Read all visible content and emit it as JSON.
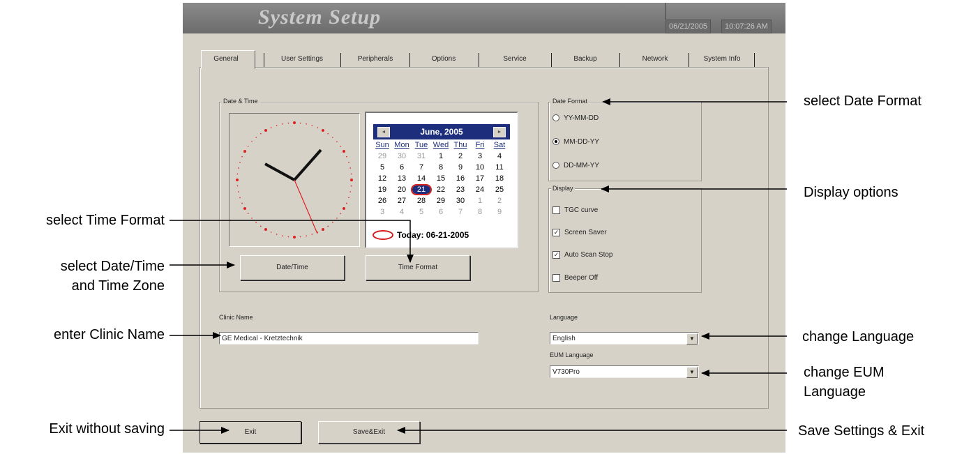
{
  "window": {
    "title": "System Setup",
    "date": "06/21/2005",
    "time": "10:07:26 AM"
  },
  "tabs": [
    "General",
    "User Settings",
    "Peripherals",
    "Options",
    "Service",
    "Backup",
    "Network",
    "System Info"
  ],
  "date_time": {
    "group_label": "Date & Time",
    "datetime_button": "Date/Time",
    "timeformat_button": "Time Format"
  },
  "calendar": {
    "month_label": "June, 2005",
    "days_of_week": [
      "Sun",
      "Mon",
      "Tue",
      "Wed",
      "Thu",
      "Fri",
      "Sat"
    ],
    "weeks": [
      [
        "29",
        "30",
        "31",
        "1",
        "2",
        "3",
        "4"
      ],
      [
        "5",
        "6",
        "7",
        "8",
        "9",
        "10",
        "11"
      ],
      [
        "12",
        "13",
        "14",
        "15",
        "16",
        "17",
        "18"
      ],
      [
        "19",
        "20",
        "21",
        "22",
        "23",
        "24",
        "25"
      ],
      [
        "26",
        "27",
        "28",
        "29",
        "30",
        "1",
        "2"
      ],
      [
        "3",
        "4",
        "5",
        "6",
        "7",
        "8",
        "9"
      ]
    ],
    "today_label": "Today: 06-21-2005",
    "selected_day": "21"
  },
  "date_format": {
    "group_label": "Date Format",
    "options": [
      "YY-MM-DD",
      "MM-DD-YY",
      "DD-MM-YY"
    ],
    "selected": "MM-DD-YY"
  },
  "display": {
    "group_label": "Display",
    "options": [
      {
        "label": "TGC curve",
        "checked": false
      },
      {
        "label": "Screen Saver",
        "checked": true
      },
      {
        "label": "Auto Scan Stop",
        "checked": true
      },
      {
        "label": "Beeper Off",
        "checked": false
      }
    ]
  },
  "clinic": {
    "label": "Clinic Name",
    "value": "GE Medical - Kretztechnik"
  },
  "language": {
    "label": "Language",
    "value": "English",
    "eum_label": "EUM Language",
    "eum_value": "V730Pro"
  },
  "buttons": {
    "exit": "Exit",
    "save_exit": "Save&Exit"
  },
  "annotations": {
    "select_date_format": "select Date Format",
    "display_options": "Display options",
    "select_time_format": "select Time Format",
    "select_datetime_1": "select Date/Time",
    "select_datetime_2": "and Time Zone",
    "enter_clinic_name": "enter Clinic Name",
    "change_language": "change Language",
    "change_eum_1": "change EUM",
    "change_eum_2": "Language",
    "exit_without_saving": "Exit without saving",
    "save_settings_exit": "Save Settings & Exit"
  },
  "colors": {
    "screen_bg": "#d6d2c8",
    "titlebar": "#6c6c6c",
    "calendar_header": "#1d2e7d",
    "clock_marks": "#e02020"
  }
}
